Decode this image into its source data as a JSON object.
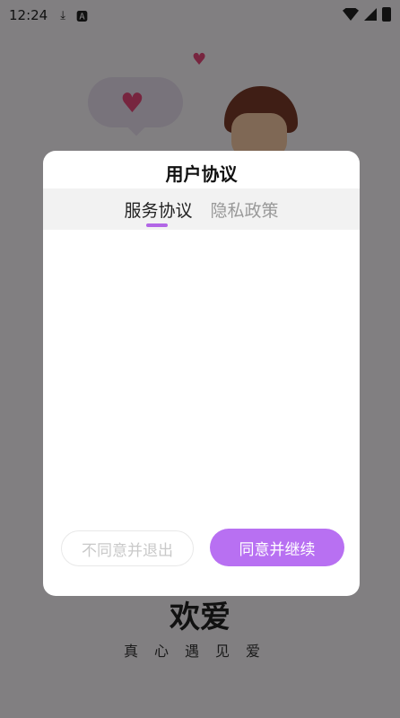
{
  "status_bar": {
    "time": "12:24",
    "icons": [
      "download-icon",
      "keyboard-icon",
      "wifi-icon",
      "signal-icon",
      "battery-icon"
    ]
  },
  "background": {
    "title": "欢爱",
    "subtitle": "真心遇见爱"
  },
  "dialog": {
    "title": "用户协议",
    "tabs": [
      {
        "label": "服务协议",
        "active": true
      },
      {
        "label": "隐私政策",
        "active": false
      }
    ],
    "buttons": {
      "disagree": "不同意并退出",
      "agree": "同意并继续"
    }
  },
  "colors": {
    "accent": "#b870f2",
    "heart": "#e5477a",
    "overlay": "rgba(0,0,0,0.48)"
  }
}
